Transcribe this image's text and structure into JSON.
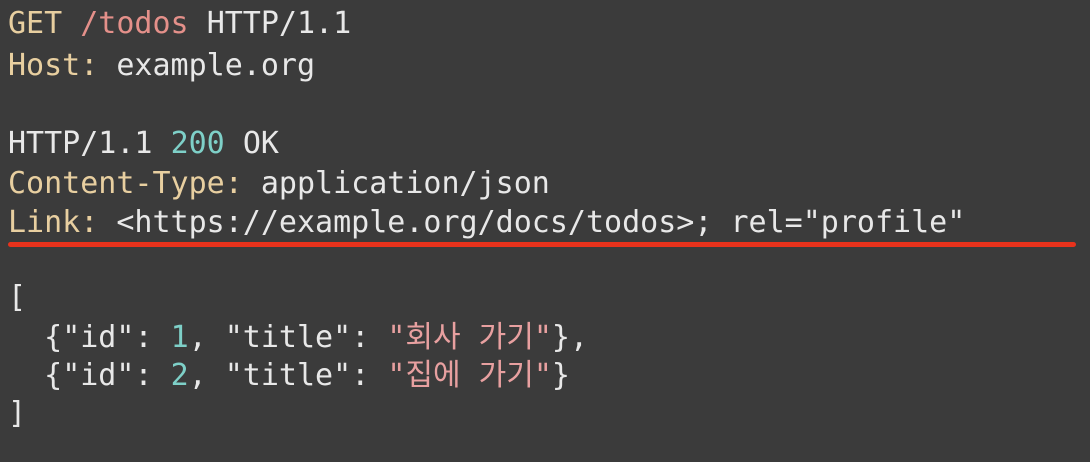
{
  "request": {
    "method": "GET",
    "path": "/todos",
    "version": "HTTP/1.1",
    "host_key": "Host",
    "host_value": "example.org"
  },
  "response": {
    "version": "HTTP/1.1",
    "status_code": "200",
    "status_text": "OK",
    "content_type_key": "Content-Type",
    "content_type_value": "application/json",
    "link_key": "Link",
    "link_value": "<https://example.org/docs/todos>; rel=\"profile\""
  },
  "body": {
    "open_bracket": "[",
    "close_bracket": "]",
    "items": [
      {
        "id_key": "\"id\"",
        "id_value": "1",
        "title_key": "\"title\"",
        "title_value": "\"회사 가기\"",
        "suffix": "},"
      },
      {
        "id_key": "\"id\"",
        "id_value": "2",
        "title_key": "\"title\"",
        "title_value": "\"집에 가기\"",
        "suffix": "}"
      }
    ]
  },
  "colors": {
    "background": "#3b3b3b",
    "underline": "#e8321c",
    "key": "#e8cfa0",
    "path": "#e4908a",
    "number": "#7ed0c8",
    "string": "#e8a0a0"
  }
}
